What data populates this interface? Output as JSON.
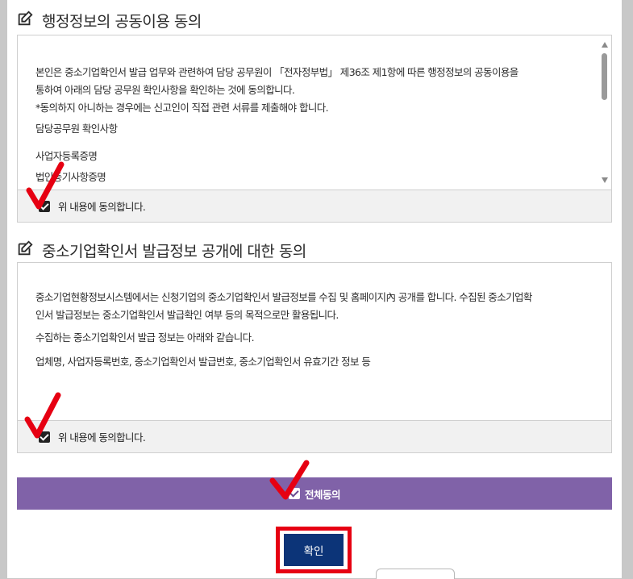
{
  "section1": {
    "title": "행정정보의 공동이용 동의",
    "lines": [
      "본인은 중소기업확인서 발급 업무와 관련하여 담당 공무원이 「전자정부법」 제36조 제1항에 따른 행정정보의 공동이용을",
      "통하여 아래의 담당 공무원 확인사항을 확인하는 것에 동의합니다.",
      "*동의하지 아니하는 경우에는 신고인이 직접 관련 서류를 제출해야 합니다.",
      "담당공무원 확인사항",
      "사업자등록증명",
      "법인등기사항증명"
    ],
    "agree_label": "위 내용에 동의합니다."
  },
  "section2": {
    "title": "중소기업확인서 발급정보 공개에 대한 동의",
    "lines": [
      "중소기업현황정보시스템에서는 신청기업의 중소기업확인서 발급정보를 수집 및 홈페이지內 공개를 합니다. 수집된 중소기업확",
      "인서 발급정보는 중소기업확인서 발급확인 여부 등의 목적으로만 활용됩니다.",
      "수집하는 중소기업확인서 발급 정보는 아래와 같습니다.",
      "업체명, 사업자등록번호, 중소기업확인서 발급번호, 중소기업확인서 유효기간 정보 등"
    ],
    "agree_label": "위 내용에 동의합니다."
  },
  "agree_all_label": "전체동의",
  "confirm_label": "확인",
  "colors": {
    "accent_purple": "#8062a8",
    "confirm_navy": "#0c3478",
    "highlight_red": "#e60012"
  },
  "icons": {
    "section_icon": "edit-icon"
  }
}
